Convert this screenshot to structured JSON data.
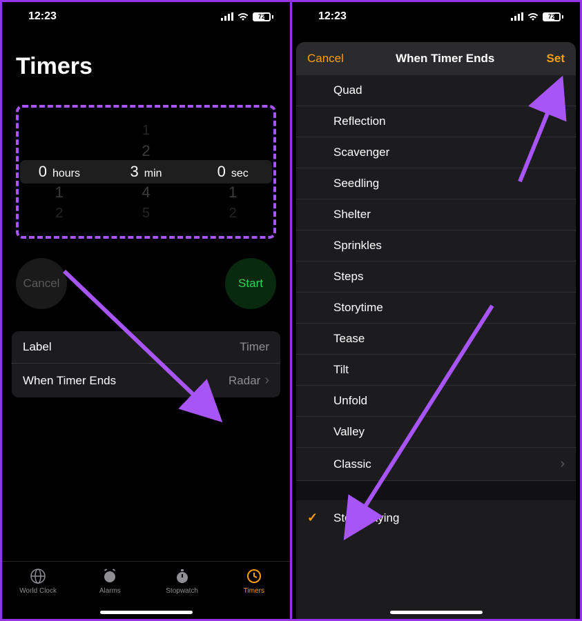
{
  "status": {
    "time": "12:23",
    "battery": "72"
  },
  "left": {
    "title": "Timers",
    "picker": {
      "hours_above": [
        "",
        ""
      ],
      "hours": "0",
      "hours_label": "hours",
      "min_above": [
        "1",
        "2"
      ],
      "min": "3",
      "min_label": "min",
      "min_below": [
        "4",
        "5"
      ],
      "sec_above": [
        "",
        ""
      ],
      "sec": "0",
      "sec_label": "sec",
      "sec_below": [
        "1",
        "2"
      ],
      "hours_below": [
        "1",
        "2"
      ]
    },
    "cancel": "Cancel",
    "start": "Start",
    "rows": {
      "label_key": "Label",
      "label_val": "Timer",
      "ends_key": "When Timer Ends",
      "ends_val": "Radar"
    },
    "tabs": {
      "world": "World Clock",
      "alarms": "Alarms",
      "stopwatch": "Stopwatch",
      "timers": "Timers"
    }
  },
  "right": {
    "cancel": "Cancel",
    "title": "When Timer Ends",
    "set": "Set",
    "sounds": [
      "Quad",
      "Reflection",
      "Scavenger",
      "Seedling",
      "Shelter",
      "Sprinkles",
      "Steps",
      "Storytime",
      "Tease",
      "Tilt",
      "Unfold",
      "Valley"
    ],
    "classic": "Classic",
    "stop": "Stop Playing"
  }
}
